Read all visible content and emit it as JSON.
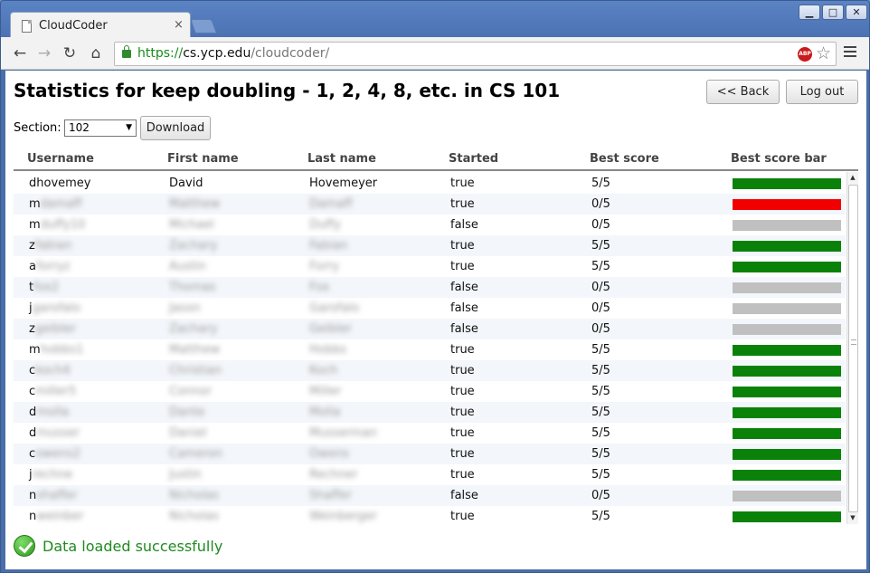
{
  "browser": {
    "tab_title": "CloudCoder",
    "tab_close": "×",
    "url_scheme": "https://",
    "url_host": "cs.ycp.edu",
    "url_path": "/cloudcoder/",
    "abp_label": "ABP"
  },
  "page": {
    "title": "Statistics for keep doubling - 1, 2, 4, 8, etc. in CS 101",
    "back_label": "<< Back",
    "logout_label": "Log out",
    "section_label": "Section:",
    "section_value": "102",
    "download_label": "Download",
    "status_text": "Data loaded successfully"
  },
  "table": {
    "columns": [
      "Username",
      "First name",
      "Last name",
      "Started",
      "Best score",
      "Best score bar"
    ],
    "rows": [
      {
        "username": "dhovemey",
        "first": "David",
        "last": "Hovemeyer",
        "started": "true",
        "score": "5/5",
        "bar": "full",
        "blur": false
      },
      {
        "username": "mdamaff",
        "first": "Matthew",
        "last": "Damaff",
        "started": "true",
        "score": "0/5",
        "bar": "fail",
        "blur": true
      },
      {
        "username": "mduffy10",
        "first": "Michael",
        "last": "Duffy",
        "started": "false",
        "score": "0/5",
        "bar": "none",
        "blur": true
      },
      {
        "username": "zfabian",
        "first": "Zachary",
        "last": "Fabian",
        "started": "true",
        "score": "5/5",
        "bar": "full",
        "blur": true
      },
      {
        "username": "aforryz",
        "first": "Austin",
        "last": "Forry",
        "started": "true",
        "score": "5/5",
        "bar": "full",
        "blur": true
      },
      {
        "username": "tfox2",
        "first": "Thomas",
        "last": "Fox",
        "started": "false",
        "score": "0/5",
        "bar": "none",
        "blur": true
      },
      {
        "username": "jgarofalo",
        "first": "Jason",
        "last": "Garofalo",
        "started": "false",
        "score": "0/5",
        "bar": "none",
        "blur": true
      },
      {
        "username": "zgeibler",
        "first": "Zachary",
        "last": "Geibler",
        "started": "false",
        "score": "0/5",
        "bar": "none",
        "blur": true
      },
      {
        "username": "mhobbs1",
        "first": "Matthew",
        "last": "Hobbs",
        "started": "true",
        "score": "5/5",
        "bar": "full",
        "blur": true
      },
      {
        "username": "ckoch4",
        "first": "Christian",
        "last": "Koch",
        "started": "true",
        "score": "5/5",
        "bar": "full",
        "blur": true
      },
      {
        "username": "cmiller5",
        "first": "Connor",
        "last": "Miller",
        "started": "true",
        "score": "5/5",
        "bar": "full",
        "blur": true
      },
      {
        "username": "dmolla",
        "first": "Dante",
        "last": "Molla",
        "started": "true",
        "score": "5/5",
        "bar": "full",
        "blur": true
      },
      {
        "username": "dmusser",
        "first": "Daniel",
        "last": "Musserman",
        "started": "true",
        "score": "5/5",
        "bar": "full",
        "blur": true
      },
      {
        "username": "cowens2",
        "first": "Cameron",
        "last": "Owens",
        "started": "true",
        "score": "5/5",
        "bar": "full",
        "blur": true
      },
      {
        "username": "jrechne",
        "first": "Justin",
        "last": "Rechner",
        "started": "true",
        "score": "5/5",
        "bar": "full",
        "blur": true
      },
      {
        "username": "nshaffer",
        "first": "Nicholas",
        "last": "Shaffer",
        "started": "false",
        "score": "0/5",
        "bar": "none",
        "blur": true
      },
      {
        "username": "nweinber",
        "first": "Nicholas",
        "last": "Weinberger",
        "started": "true",
        "score": "5/5",
        "bar": "full",
        "blur": true
      }
    ]
  },
  "colors": {
    "bar_full": "#0a820a",
    "bar_fail": "#f20000",
    "bar_none": "#c0c0c0"
  }
}
